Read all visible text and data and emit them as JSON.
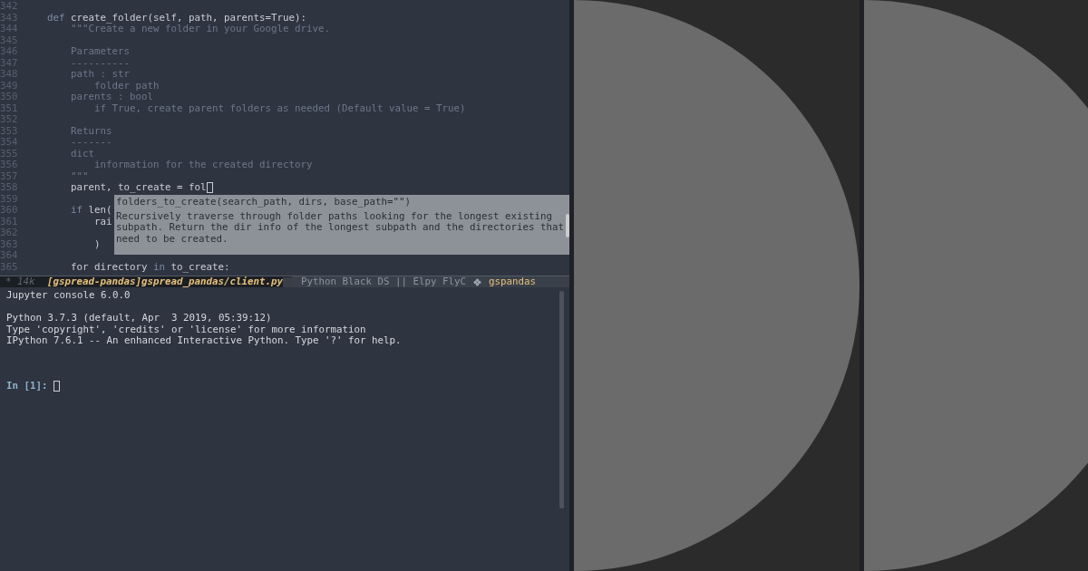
{
  "editor": {
    "lines": [
      {
        "number": "342",
        "cursor": false
      },
      {
        "number": "343",
        "cursor": false,
        "segments": [
          {
            "text": "    def",
            "kind": "keyword"
          },
          {
            "text": " create_folder(",
            "kind": "plain"
          },
          {
            "text": "self",
            "kind": "builtin"
          },
          {
            "text": ", path, parents=",
            "kind": "plain"
          },
          {
            "text": "True",
            "kind": "builtin"
          },
          {
            "text": "):",
            "kind": "plain"
          }
        ]
      },
      {
        "number": "344",
        "cursor": false,
        "segments": [
          {
            "text": "        \"\"\"Create a new folder in your Google drive.",
            "kind": "doc"
          }
        ]
      },
      {
        "number": "345",
        "cursor": false
      },
      {
        "number": "346",
        "cursor": false,
        "segments": [
          {
            "text": "        Parameters",
            "kind": "doc"
          }
        ]
      },
      {
        "number": "347",
        "cursor": false,
        "segments": [
          {
            "text": "        ----------",
            "kind": "doc"
          }
        ]
      },
      {
        "number": "348",
        "cursor": false,
        "segments": [
          {
            "text": "        path : str",
            "kind": "doc"
          }
        ]
      },
      {
        "number": "349",
        "cursor": false,
        "segments": [
          {
            "text": "            folder path",
            "kind": "doc"
          }
        ]
      },
      {
        "number": "350",
        "cursor": false,
        "segments": [
          {
            "text": "        parents : bool",
            "kind": "doc"
          }
        ]
      },
      {
        "number": "351",
        "cursor": false,
        "segments": [
          {
            "text": "            if True, create parent folders as needed (Default value = True)",
            "kind": "doc"
          }
        ]
      },
      {
        "number": "352",
        "cursor": false
      },
      {
        "number": "353",
        "cursor": false,
        "segments": [
          {
            "text": "        Returns",
            "kind": "doc"
          }
        ]
      },
      {
        "number": "354",
        "cursor": false,
        "segments": [
          {
            "text": "        -------",
            "kind": "doc"
          }
        ]
      },
      {
        "number": "355",
        "cursor": false,
        "segments": [
          {
            "text": "        dict",
            "kind": "doc"
          }
        ]
      },
      {
        "number": "356",
        "cursor": false,
        "segments": [
          {
            "text": "            information for the created directory",
            "kind": "doc"
          }
        ]
      },
      {
        "number": "357",
        "cursor": false,
        "segments": [
          {
            "text": "        \"\"\"",
            "kind": "doc"
          }
        ]
      },
      {
        "number": "358",
        "cursor": true,
        "segments": [
          {
            "text": "        parent, to_create = fol",
            "kind": "plain"
          }
        ]
      },
      {
        "number": "359",
        "cursor": false
      },
      {
        "number": "360",
        "cursor": false,
        "segments": [
          {
            "text": "        if",
            "kind": "keyword"
          },
          {
            "text": " len(",
            "kind": "plain"
          }
        ]
      },
      {
        "number": "361",
        "cursor": false,
        "segments": [
          {
            "text": "            rai",
            "kind": "plain"
          }
        ]
      },
      {
        "number": "362",
        "cursor": false
      },
      {
        "number": "363",
        "cursor": false,
        "segments": [
          {
            "text": "            )",
            "kind": "plain"
          }
        ]
      },
      {
        "number": "364",
        "cursor": false
      },
      {
        "number": "365",
        "cursor": false,
        "segments": [
          {
            "text": "        for",
            "kind": "plain"
          },
          {
            "text": " directory ",
            "kind": "plain"
          },
          {
            "text": "in",
            "kind": "keyword"
          },
          {
            "text": " to_create:",
            "kind": "plain"
          }
        ]
      }
    ],
    "completion": {
      "signature": "folders_to_create(search_path, dirs, base_path=\"\")",
      "doc_lines": [
        "Recursively traverse through folder paths looking for the longest existing",
        "subpath. Return the dir info of the longest subpath and the directories that",
        "need to be created."
      ]
    }
  },
  "mode_line": {
    "state": "* 14k",
    "buffer": "[gspread-pandas]gspread_pandas/client.py",
    "modes": "Python Black DS || Elpy FlyC",
    "env": "gspandas"
  },
  "console": {
    "banner": "Jupyter console 6.0.0",
    "info": [
      "Python 3.7.3 (default, Apr  3 2019, 05:39:12)",
      "Type 'copyright', 'credits' or 'license' for more information",
      "IPython 7.6.1 -- An enhanced Interactive Python. Type '?' for help."
    ],
    "prompt": "In [1]:"
  }
}
